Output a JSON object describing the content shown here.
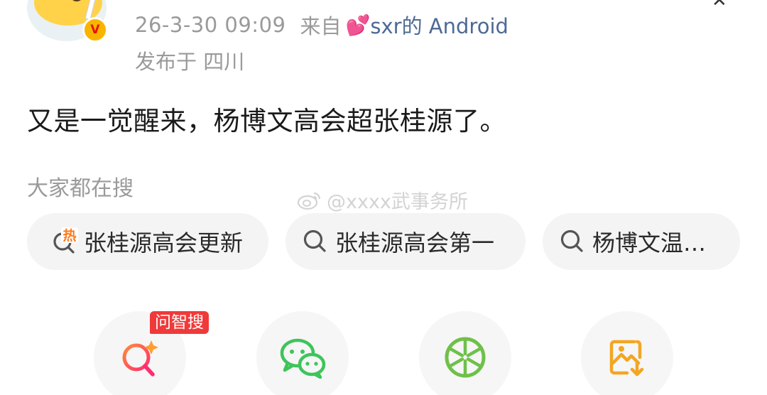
{
  "post": {
    "meta": {
      "date": "26-3-30 09:09",
      "from_label": "来自",
      "source_emoji": "💕",
      "source": "sxr的 Android"
    },
    "location": "发布于 四川",
    "verified_mark": "V",
    "text": "又是一觉醒来，杨博文高会超张桂源了。"
  },
  "watermark": "@xxxx武事务所",
  "search": {
    "label": "大家都在搜",
    "chips": [
      {
        "label": "张桂源高会更新",
        "icon": "hot-search-icon",
        "hot_mark": "热"
      },
      {
        "label": "张桂源高会第一",
        "icon": "search-icon"
      },
      {
        "label": "杨博文温…",
        "icon": "search-icon"
      }
    ]
  },
  "share": {
    "ai_badge": "问智搜",
    "buttons": [
      {
        "icon": "ai-search-icon"
      },
      {
        "icon": "wechat-icon"
      },
      {
        "icon": "moments-icon"
      },
      {
        "icon": "save-image-icon"
      }
    ]
  },
  "colors": {
    "source_link": "#4d6a96",
    "badge_red": "#f03a3a",
    "wechat_green": "#3ec45b",
    "moments_green": "#6fc04a",
    "save_orange": "#f3a623"
  }
}
